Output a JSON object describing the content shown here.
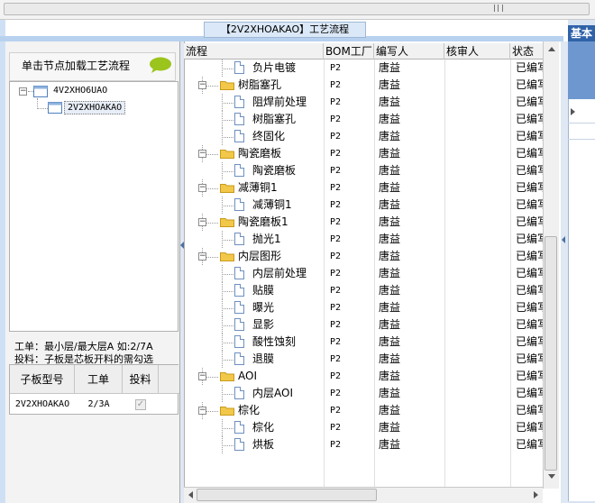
{
  "window": {
    "title": "【2V2XHOAKAO】工艺流程"
  },
  "left_panel": {
    "load_label": "单击节点加载工艺流程",
    "tree": [
      {
        "label": "4V2XHO6UAO",
        "expanded": true
      },
      {
        "label": "2V2XHOAKAO",
        "selected": true
      }
    ],
    "hint_line1": "工单：最小层/最大层A 如:2/7A",
    "hint_line2": "投料：子板是芯板开料的需勾选",
    "sub_table": {
      "headers": [
        "子板型号",
        "工单",
        "投料"
      ],
      "rows": [
        {
          "model": "2V2XHOAKAO",
          "order": "2/3A",
          "feed_checked": true
        }
      ]
    }
  },
  "grid": {
    "headers": [
      "流程",
      "BOM工厂",
      "编写人",
      "核审人",
      "状态"
    ],
    "rows": [
      {
        "name": "负片电镀",
        "level": 2,
        "type": "file",
        "bom": "P2",
        "writer": "唐益",
        "reviewer": "",
        "status": "已编写"
      },
      {
        "name": "树脂塞孔",
        "level": 1,
        "type": "folder",
        "bom": "P2",
        "writer": "唐益",
        "reviewer": "",
        "status": "已编写"
      },
      {
        "name": "阻焊前处理",
        "level": 2,
        "type": "file",
        "bom": "P2",
        "writer": "唐益",
        "reviewer": "",
        "status": "已编写"
      },
      {
        "name": "树脂塞孔",
        "level": 2,
        "type": "file",
        "bom": "P2",
        "writer": "唐益",
        "reviewer": "",
        "status": "已编写"
      },
      {
        "name": "终固化",
        "level": 2,
        "type": "file",
        "bom": "P2",
        "writer": "唐益",
        "reviewer": "",
        "status": "已编写"
      },
      {
        "name": "陶瓷磨板",
        "level": 1,
        "type": "folder",
        "bom": "P2",
        "writer": "唐益",
        "reviewer": "",
        "status": "已编写"
      },
      {
        "name": "陶瓷磨板",
        "level": 2,
        "type": "file",
        "bom": "P2",
        "writer": "唐益",
        "reviewer": "",
        "status": "已编写"
      },
      {
        "name": "减薄铜1",
        "level": 1,
        "type": "folder",
        "bom": "P2",
        "writer": "唐益",
        "reviewer": "",
        "status": "已编写"
      },
      {
        "name": "减薄铜1",
        "level": 2,
        "type": "file",
        "bom": "P2",
        "writer": "唐益",
        "reviewer": "",
        "status": "已编写"
      },
      {
        "name": "陶瓷磨板1",
        "level": 1,
        "type": "folder",
        "bom": "P2",
        "writer": "唐益",
        "reviewer": "",
        "status": "已编写"
      },
      {
        "name": "抛光1",
        "level": 2,
        "type": "file",
        "bom": "P2",
        "writer": "唐益",
        "reviewer": "",
        "status": "已编写"
      },
      {
        "name": "内层图形",
        "level": 1,
        "type": "folder",
        "bom": "P2",
        "writer": "唐益",
        "reviewer": "",
        "status": "已编写"
      },
      {
        "name": "内层前处理",
        "level": 2,
        "type": "file",
        "bom": "P2",
        "writer": "唐益",
        "reviewer": "",
        "status": "已编写"
      },
      {
        "name": "贴膜",
        "level": 2,
        "type": "file",
        "bom": "P2",
        "writer": "唐益",
        "reviewer": "",
        "status": "已编写"
      },
      {
        "name": "曝光",
        "level": 2,
        "type": "file",
        "bom": "P2",
        "writer": "唐益",
        "reviewer": "",
        "status": "已编写"
      },
      {
        "name": "显影",
        "level": 2,
        "type": "file",
        "bom": "P2",
        "writer": "唐益",
        "reviewer": "",
        "status": "已编写"
      },
      {
        "name": "酸性蚀刻",
        "level": 2,
        "type": "file",
        "bom": "P2",
        "writer": "唐益",
        "reviewer": "",
        "status": "已编写"
      },
      {
        "name": "退膜",
        "level": 2,
        "type": "file",
        "bom": "P2",
        "writer": "唐益",
        "reviewer": "",
        "status": "已编写"
      },
      {
        "name": "AOI",
        "level": 1,
        "type": "folder",
        "bom": "P2",
        "writer": "唐益",
        "reviewer": "",
        "status": "已编写"
      },
      {
        "name": "内层AOI",
        "level": 2,
        "type": "file",
        "bom": "P2",
        "writer": "唐益",
        "reviewer": "",
        "status": "已编写"
      },
      {
        "name": "棕化",
        "level": 1,
        "type": "folder",
        "bom": "P2",
        "writer": "唐益",
        "reviewer": "",
        "status": "已编写"
      },
      {
        "name": "棕化",
        "level": 2,
        "type": "file",
        "bom": "P2",
        "writer": "唐益",
        "reviewer": "",
        "status": "已编写"
      },
      {
        "name": "烘板",
        "level": 2,
        "type": "file",
        "bom": "P2",
        "writer": "唐益",
        "reviewer": "",
        "status": "已编写"
      }
    ]
  },
  "right_panel": {
    "tab_label": "基本"
  },
  "colors": {
    "accent_blue": "#2f62a8",
    "folder_yellow": "#f2c84b",
    "speech_green": "#9bc41c"
  },
  "icons": {
    "folder": "folder-icon",
    "file": "file-icon",
    "speech": "speech-bubble-icon"
  }
}
